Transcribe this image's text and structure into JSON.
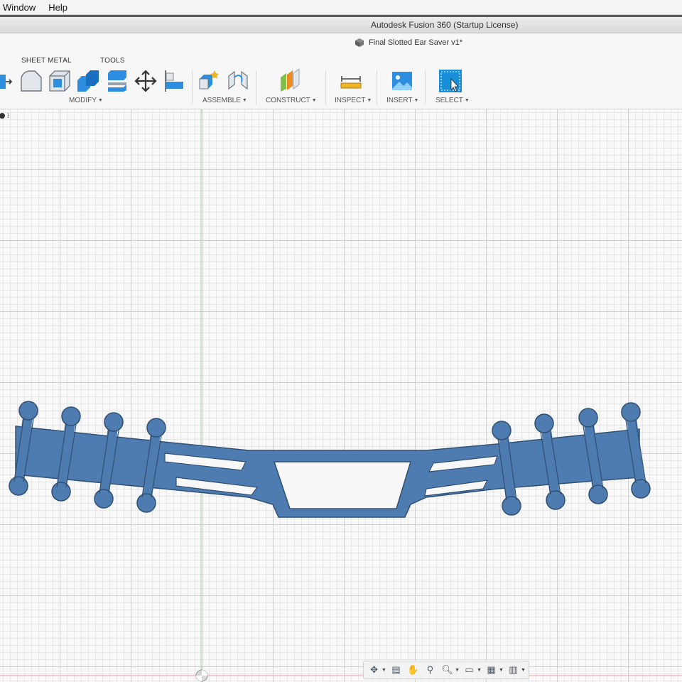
{
  "menubar": {
    "items": [
      "Window",
      "Help"
    ]
  },
  "window": {
    "title": "Autodesk Fusion 360 (Startup License)"
  },
  "document": {
    "tab_title": "Final Slotted Ear Saver v1*"
  },
  "toolbar": {
    "tabs": [
      "SHEET METAL",
      "TOOLS"
    ],
    "groups": {
      "modify": "MODIFY",
      "assemble": "ASSEMBLE",
      "construct": "CONSTRUCT",
      "inspect": "INSPECT",
      "insert": "INSERT",
      "select": "SELECT"
    },
    "icons": [
      "press-pull-icon",
      "fillet-icon",
      "shell-icon",
      "combine-icon",
      "replace-face-icon",
      "move-icon",
      "align-icon",
      "new-component-icon",
      "joint-icon",
      "offset-plane-icon",
      "measure-icon",
      "insert-image-icon",
      "select-icon"
    ]
  },
  "canvas": {
    "model": "slotted-ear-saver",
    "model_color": "#4f7cb0",
    "grid": true
  },
  "navbar": {
    "icons": [
      "orbit-icon",
      "look-at-icon",
      "pan-icon",
      "zoom-icon",
      "fit-icon",
      "display-settings-icon",
      "grid-settings-icon",
      "viewports-icon"
    ]
  },
  "colors": {
    "accent": "#1a8fd9",
    "toolbar_bg": "#f7f7f7",
    "part_blue": "#4f7cb0"
  }
}
